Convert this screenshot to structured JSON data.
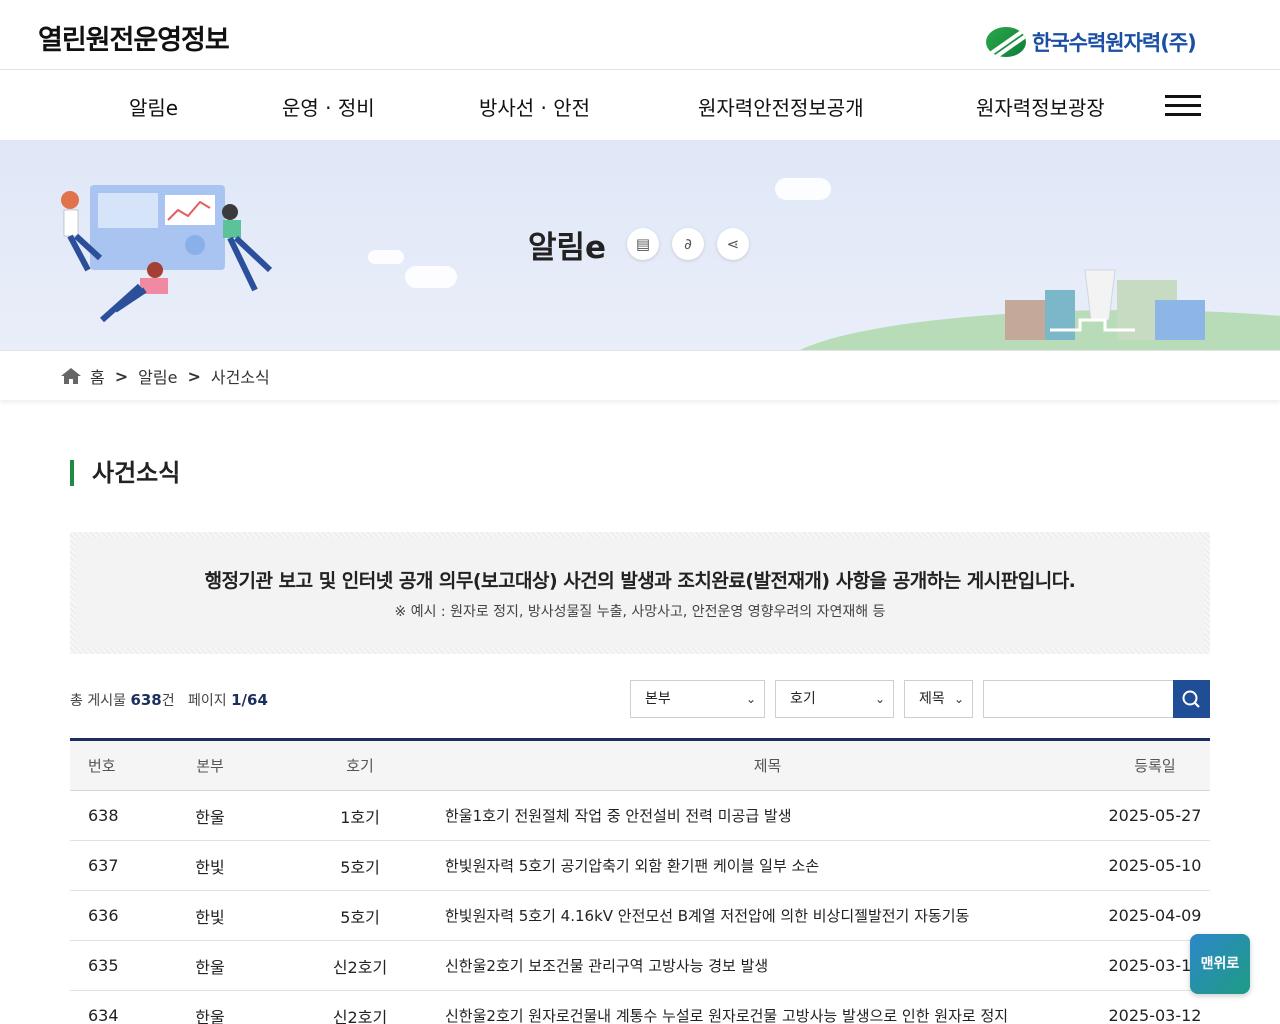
{
  "header": {
    "site_title": "열린원전운영정보",
    "logo_text": "한국수력원자력(주)"
  },
  "gnb": {
    "items": [
      "알림e",
      "운영 · 정비",
      "방사선 · 안전",
      "원자력안전정보공개",
      "원자력정보광장"
    ]
  },
  "visual": {
    "title": "알림e",
    "util_icons": [
      "print-icon",
      "link-icon",
      "share-icon"
    ]
  },
  "breadcrumb": {
    "home": "홈",
    "level1": "알림e",
    "level2": "사건소식"
  },
  "page": {
    "title": "사건소식",
    "notice_main": "행정기관 보고 및 인터넷 공개 의무(보고대상) 사건의 발생과 조치완료(발전재개) 사항을 공개하는 게시판입니다.",
    "notice_sub": "※ 예시 : 원자로 정지, 방사성물질 누출, 사망사고, 안전운영 영향우려의 자연재해 등"
  },
  "list_info": {
    "total_label": "총 게시물",
    "total_count": "638",
    "total_unit": "건",
    "page_label": "페이지",
    "page_value": "1/64"
  },
  "filters": {
    "headquarters": "본부",
    "unit": "호기",
    "field": "제목",
    "search_value": ""
  },
  "table": {
    "headers": [
      "번호",
      "본부",
      "호기",
      "제목",
      "등록일"
    ],
    "rows": [
      [
        "638",
        "한울",
        "1호기",
        "한울1호기 전원절체 작업 중 안전설비 전력 미공급 발생",
        "2025-05-27"
      ],
      [
        "637",
        "한빛",
        "5호기",
        "한빛원자력 5호기 공기압축기 외함 환기팬 케이블 일부 소손",
        "2025-05-10"
      ],
      [
        "636",
        "한빛",
        "5호기",
        "한빛원자력 5호기 4.16kV 안전모선 B계열 저전압에 의한 비상디젤발전기 자동기동",
        "2025-04-09"
      ],
      [
        "635",
        "한울",
        "신2호기",
        "신한울2호기 보조건물 관리구역 고방사능 경보 발생",
        "2025-03-14"
      ],
      [
        "634",
        "한울",
        "신2호기",
        "신한울2호기 원자로건물내 계통수 누설로 원자로건물 고방사능 발생으로 인한 원자로 정지",
        "2025-03-12"
      ]
    ]
  },
  "totop": "맨위로",
  "colors": {
    "accent_green": "#1f8a43",
    "navy": "#1b2f5e",
    "search_blue": "#1f4e96"
  }
}
